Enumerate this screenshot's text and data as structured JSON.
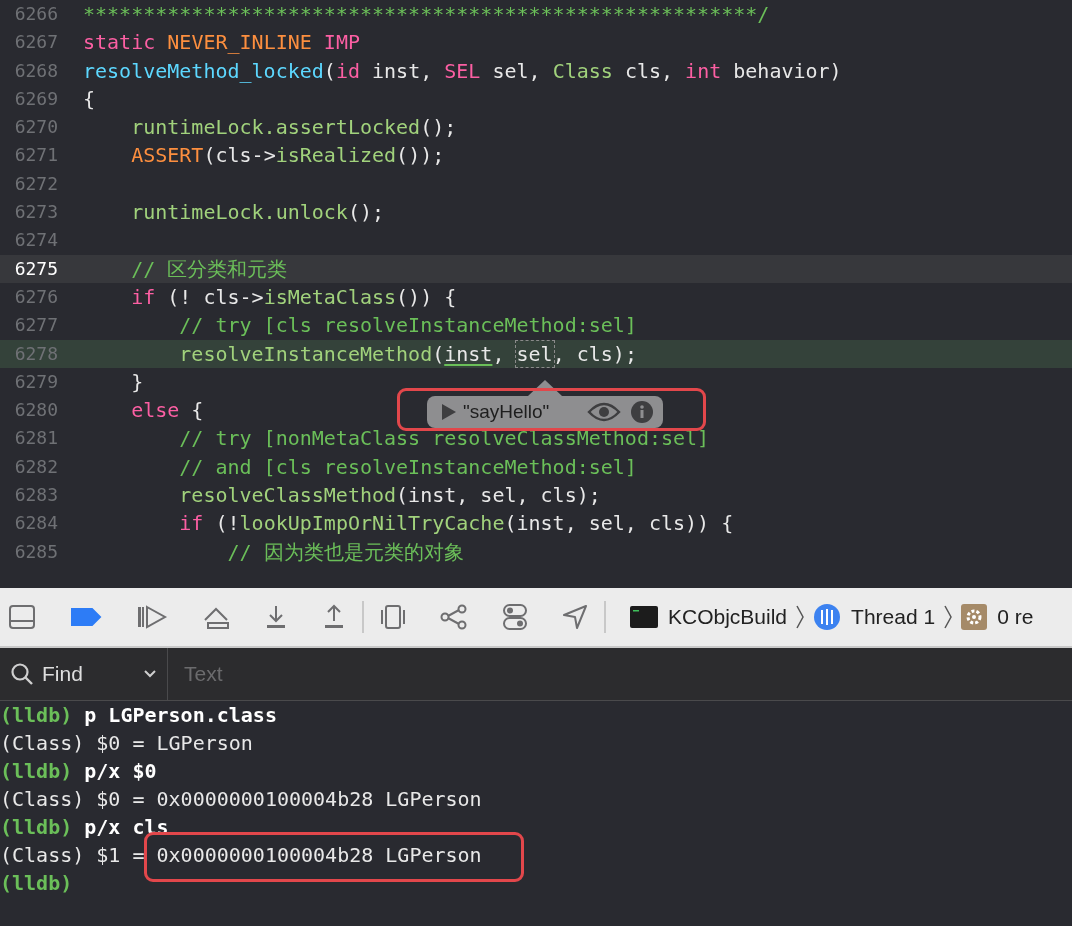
{
  "editor": {
    "lines": [
      {
        "number": "6266",
        "current": false,
        "stopped": false,
        "tokens": [
          {
            "text": "********************************************************/",
            "kind": "comment"
          }
        ]
      },
      {
        "number": "6267",
        "current": false,
        "stopped": false,
        "tokens": [
          {
            "text": "static ",
            "kind": "keyword"
          },
          {
            "text": "NEVER_INLINE ",
            "kind": "macro"
          },
          {
            "text": "IMP",
            "kind": "keyword"
          }
        ]
      },
      {
        "number": "6268",
        "current": false,
        "stopped": false,
        "tokens": [
          {
            "text": "resolveMethod_locked",
            "kind": "decl"
          },
          {
            "text": "(",
            "kind": "plain"
          },
          {
            "text": "id",
            "kind": "keyword"
          },
          {
            "text": " inst, ",
            "kind": "plain"
          },
          {
            "text": "SEL",
            "kind": "keyword"
          },
          {
            "text": " sel, ",
            "kind": "plain"
          },
          {
            "text": "Class",
            "kind": "type"
          },
          {
            "text": " cls, ",
            "kind": "plain"
          },
          {
            "text": "int",
            "kind": "keyword"
          },
          {
            "text": " behavior)",
            "kind": "plain"
          }
        ]
      },
      {
        "number": "6269",
        "current": false,
        "stopped": false,
        "tokens": [
          {
            "text": "{",
            "kind": "plain"
          }
        ]
      },
      {
        "number": "6270",
        "current": false,
        "stopped": false,
        "tokens": [
          {
            "text": "    runtimeLock.assertLocked",
            "kind": "call"
          },
          {
            "text": "();",
            "kind": "plain"
          }
        ]
      },
      {
        "number": "6271",
        "current": false,
        "stopped": false,
        "tokens": [
          {
            "text": "    ASSERT",
            "kind": "macro"
          },
          {
            "text": "(cls->",
            "kind": "plain"
          },
          {
            "text": "isRealized",
            "kind": "call"
          },
          {
            "text": "());",
            "kind": "plain"
          }
        ]
      },
      {
        "number": "6272",
        "current": false,
        "stopped": false
      },
      {
        "number": "6273",
        "current": false,
        "stopped": false,
        "tokens": [
          {
            "text": "    runtimeLock.unlock",
            "kind": "call"
          },
          {
            "text": "();",
            "kind": "plain"
          }
        ]
      },
      {
        "number": "6274",
        "current": false,
        "stopped": false
      },
      {
        "number": "6275",
        "current": true,
        "stopped": false,
        "tokens": [
          {
            "text": "    // 区分类和元类",
            "kind": "comment"
          }
        ]
      },
      {
        "number": "6276",
        "current": false,
        "stopped": false,
        "tokens": [
          {
            "text": "    if",
            "kind": "keyword"
          },
          {
            "text": " (! cls->",
            "kind": "plain"
          },
          {
            "text": "isMetaClass",
            "kind": "call"
          },
          {
            "text": "()) {",
            "kind": "plain"
          }
        ]
      },
      {
        "number": "6277",
        "current": false,
        "stopped": false,
        "tokens": [
          {
            "text": "        // try [cls resolveInstanceMethod:sel]",
            "kind": "comment"
          }
        ]
      },
      {
        "number": "6278",
        "current": false,
        "stopped": true,
        "tokens": [
          {
            "text": "        resolveInstanceMethod",
            "kind": "call"
          },
          {
            "text": "(",
            "kind": "plain"
          },
          {
            "text": "inst",
            "kind": "plain",
            "underlined": true
          },
          {
            "text": ", ",
            "kind": "plain"
          },
          {
            "text": "sel",
            "kind": "plain",
            "hovered": true
          },
          {
            "text": ", cls);",
            "kind": "plain"
          }
        ]
      },
      {
        "number": "6279",
        "current": false,
        "stopped": false,
        "tokens": [
          {
            "text": "    }",
            "kind": "plain"
          }
        ]
      },
      {
        "number": "6280",
        "current": false,
        "stopped": false,
        "tokens": [
          {
            "text": "    else",
            "kind": "keyword"
          },
          {
            "text": " {",
            "kind": "plain"
          }
        ]
      },
      {
        "number": "6281",
        "current": false,
        "stopped": false,
        "tokens": [
          {
            "text": "        // try [nonMetaClass resolveClassMethod:sel]",
            "kind": "comment"
          }
        ]
      },
      {
        "number": "6282",
        "current": false,
        "stopped": false,
        "tokens": [
          {
            "text": "        // and [cls resolveInstanceMethod:sel]",
            "kind": "comment"
          }
        ]
      },
      {
        "number": "6283",
        "current": false,
        "stopped": false,
        "tokens": [
          {
            "text": "        resolveClassMethod",
            "kind": "call"
          },
          {
            "text": "(inst, sel, cls);",
            "kind": "plain"
          }
        ]
      },
      {
        "number": "6284",
        "current": false,
        "stopped": false,
        "tokens": [
          {
            "text": "        if",
            "kind": "keyword"
          },
          {
            "text": " (!",
            "kind": "plain"
          },
          {
            "text": "lookUpImpOrNilTryCache",
            "kind": "call"
          },
          {
            "text": "(inst, sel, cls)) {",
            "kind": "plain"
          }
        ]
      },
      {
        "number": "6285",
        "current": false,
        "stopped": false,
        "tokens": [
          {
            "text": "            // 因为类也是元类的对象",
            "kind": "comment"
          }
        ]
      }
    ]
  },
  "value_popover": {
    "value": "\"sayHello\""
  },
  "debug_bar": {
    "breakpoints_on": true,
    "breadcrumbs": [
      {
        "kind": "target",
        "label": "KCObjcBuild"
      },
      {
        "kind": "thread",
        "label": "Thread 1"
      },
      {
        "kind": "frame",
        "label": "0 re"
      }
    ]
  },
  "console": {
    "filter": {
      "label": "Find",
      "placeholder": "Text"
    },
    "lines": [
      {
        "kind": "input",
        "prompt": "(lldb)",
        "text": "p LGPerson.class"
      },
      {
        "kind": "output",
        "text": "(Class) $0 = LGPerson"
      },
      {
        "kind": "input",
        "prompt": "(lldb)",
        "text": "p/x $0"
      },
      {
        "kind": "output",
        "text": "(Class) $0 = 0x0000000100004b28 LGPerson"
      },
      {
        "kind": "input",
        "prompt": "(lldb)",
        "text": "p/x cls"
      },
      {
        "kind": "output",
        "text": "(Class) $1 = 0x0000000100004b28 LGPerson"
      },
      {
        "kind": "input",
        "prompt": "(lldb)"
      }
    ]
  }
}
